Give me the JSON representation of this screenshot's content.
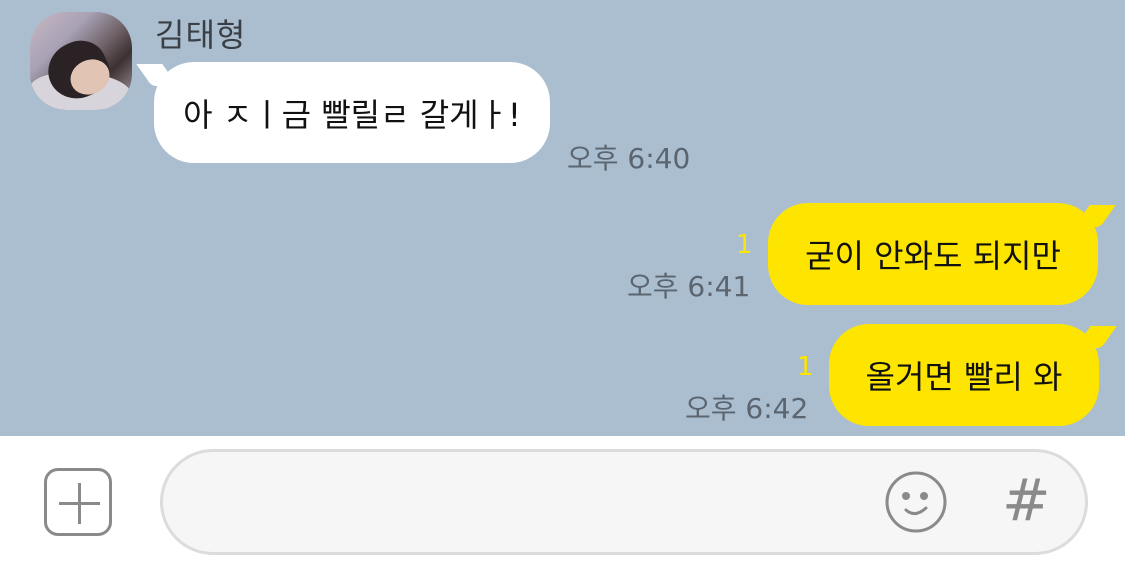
{
  "chat": {
    "sender": {
      "name": "김태형",
      "avatar_icon": "profile-photo"
    },
    "messages": [
      {
        "direction": "incoming",
        "text": "아 ㅈㅣ금 빨릴ㄹ 갈게ㅏ!",
        "time": "오후 6:40",
        "unread": ""
      },
      {
        "direction": "outgoing",
        "text": "굳이 안와도 되지만",
        "time": "오후 6:41",
        "unread": "1"
      },
      {
        "direction": "outgoing",
        "text": "올거면 빨리 와",
        "time": "오후 6:42",
        "unread": "1"
      }
    ],
    "colors": {
      "background": "#aabed0",
      "incoming_bubble": "#ffffff",
      "outgoing_bubble": "#fee500",
      "unread_count": "#fee500"
    }
  },
  "composer": {
    "plus_icon": "plus-square-icon",
    "input_placeholder": "",
    "emoji_icon": "smiley-icon",
    "hash_label": "#"
  }
}
